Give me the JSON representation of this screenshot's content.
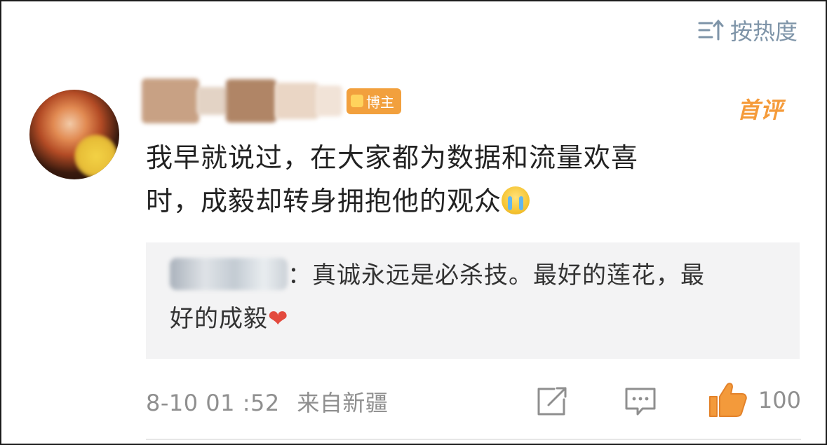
{
  "sort": {
    "label": "按热度",
    "icon": "sort-icon"
  },
  "comment": {
    "badge": "博主",
    "tag": "首评",
    "text_line1": "我早就说过，在大家都为数据和流量欢喜",
    "text_line2": "时，成毅却转身拥抱他的观众",
    "emoji": "crying-face-icon"
  },
  "reply": {
    "text_line1": "：真诚永远是必杀技。最好的莲花，最",
    "text_line2": "好的成毅",
    "emoji": "heart-icon"
  },
  "footer": {
    "timestamp": "8-10 01 :52",
    "location": "来自新疆",
    "like_count": "100"
  },
  "colors": {
    "accent_orange": "#f59b3a",
    "sort_blue": "#7e94a8",
    "meta_gray": "#8f8f8f",
    "reply_bg": "#f3f3f4"
  }
}
